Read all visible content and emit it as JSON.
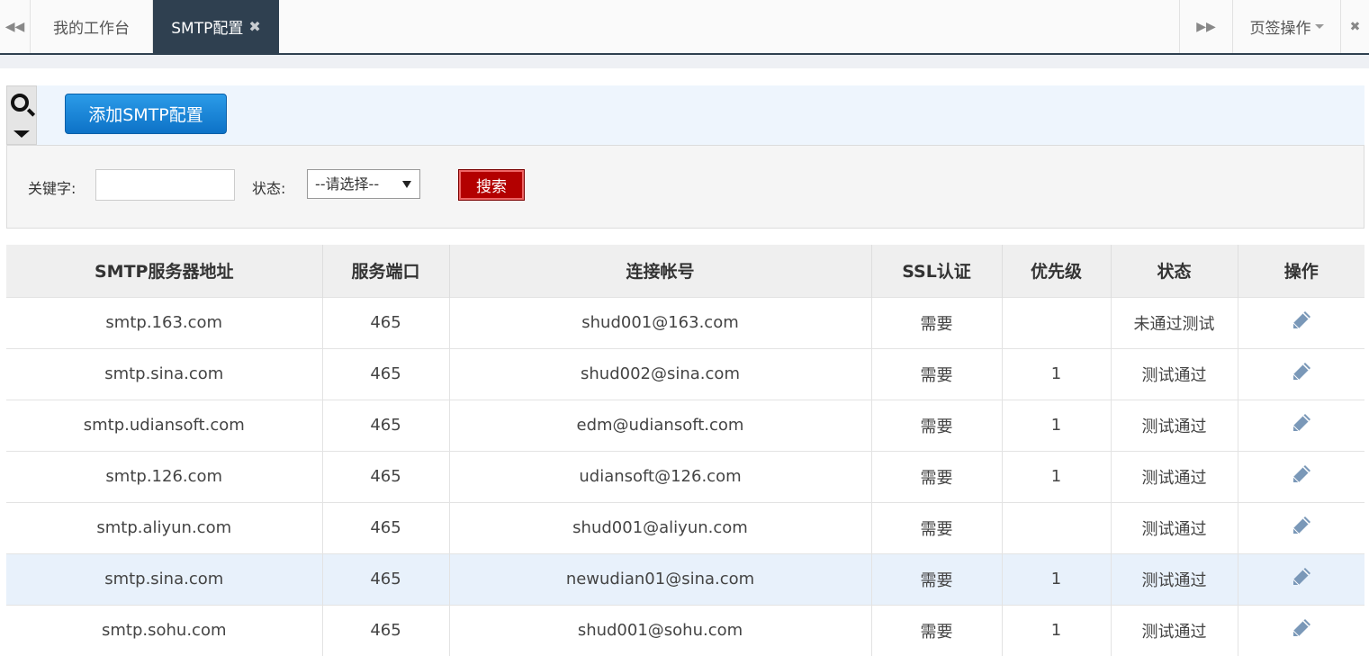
{
  "tabs": {
    "home_label": "我的工作台",
    "active_label": "SMTP配置",
    "close_glyph": "✖",
    "ops_label": "页签操作"
  },
  "toolbar": {
    "add_label": "添加SMTP配置"
  },
  "search": {
    "keyword_label": "关键字:",
    "keyword_value": "",
    "status_label": "状态:",
    "status_selected": "--请选择--",
    "search_label": "搜索"
  },
  "table": {
    "headers": [
      "SMTP服务器地址",
      "服务端口",
      "连接帐号",
      "SSL认证",
      "优先级",
      "状态",
      "操作"
    ],
    "rows": [
      {
        "server": "smtp.163.com",
        "port": "465",
        "account": "shud001@163.com",
        "ssl": "需要",
        "priority": "",
        "status": "未通过测试"
      },
      {
        "server": "smtp.sina.com",
        "port": "465",
        "account": "shud002@sina.com",
        "ssl": "需要",
        "priority": "1",
        "status": "测试通过"
      },
      {
        "server": "smtp.udiansoft.com",
        "port": "465",
        "account": "edm@udiansoft.com",
        "ssl": "需要",
        "priority": "1",
        "status": "测试通过"
      },
      {
        "server": "smtp.126.com",
        "port": "465",
        "account": "udiansoft@126.com",
        "ssl": "需要",
        "priority": "1",
        "status": "测试通过"
      },
      {
        "server": "smtp.aliyun.com",
        "port": "465",
        "account": "shud001@aliyun.com",
        "ssl": "需要",
        "priority": "",
        "status": "测试通过"
      },
      {
        "server": "smtp.sina.com",
        "port": "465",
        "account": "newudian01@sina.com",
        "ssl": "需要",
        "priority": "1",
        "status": "测试通过"
      },
      {
        "server": "smtp.sohu.com",
        "port": "465",
        "account": "shud001@sohu.com",
        "ssl": "需要",
        "priority": "1",
        "status": "测试通过"
      }
    ],
    "highlighted_row": 5
  },
  "colors": {
    "tab_active_bg": "#2f4050",
    "add_button": "#1a86d8",
    "search_button": "#b30000",
    "row_highlight": "#e8f1fb",
    "edit_icon": "#7a98b8"
  },
  "icons": {
    "tab_prev": "backward-icon",
    "tab_next": "forward-icon",
    "exit": "exit-icon",
    "search_toggle": "search-icon",
    "edit": "pencil-icon"
  }
}
